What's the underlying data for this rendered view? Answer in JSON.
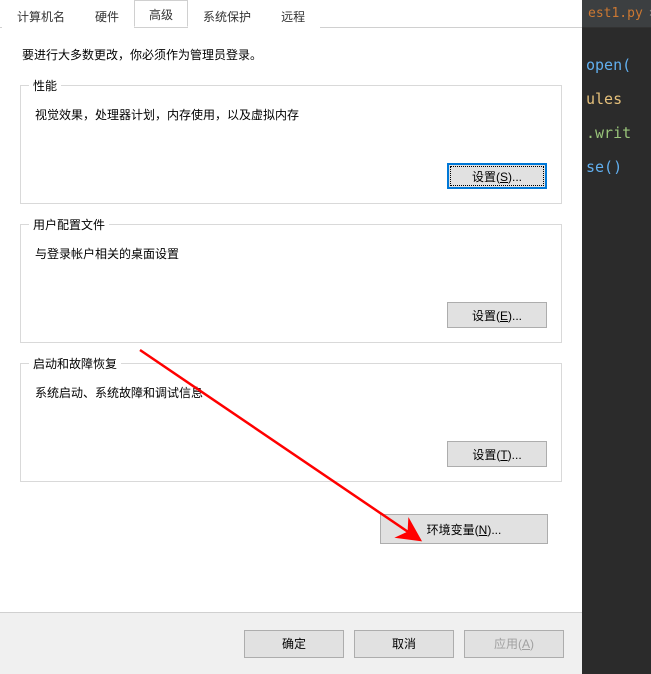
{
  "tabs": {
    "items": [
      "计算机名",
      "硬件",
      "高级",
      "系统保护",
      "远程"
    ],
    "actived_index": 2
  },
  "intro": "要进行大多数更改，你必须作为管理员登录。",
  "groups": {
    "performance": {
      "title": "性能",
      "desc": "视觉效果，处理器计划，内存使用，以及虚拟内存",
      "button_text": "设置",
      "button_accel": "S"
    },
    "profiles": {
      "title": "用户配置文件",
      "desc": "与登录帐户相关的桌面设置",
      "button_text": "设置",
      "button_accel": "E"
    },
    "startup": {
      "title": "启动和故障恢复",
      "desc": "系统启动、系统故障和调试信息",
      "button_text": "设置",
      "button_accel": "T"
    }
  },
  "env_button": {
    "text": "环境变量",
    "accel": "N"
  },
  "footer": {
    "ok": "确定",
    "cancel": "取消",
    "apply_text": "应用",
    "apply_accel": "A"
  },
  "editor": {
    "tab": "est1.py",
    "lines": [
      "open(",
      "ules",
      ".writ",
      "se()"
    ]
  }
}
